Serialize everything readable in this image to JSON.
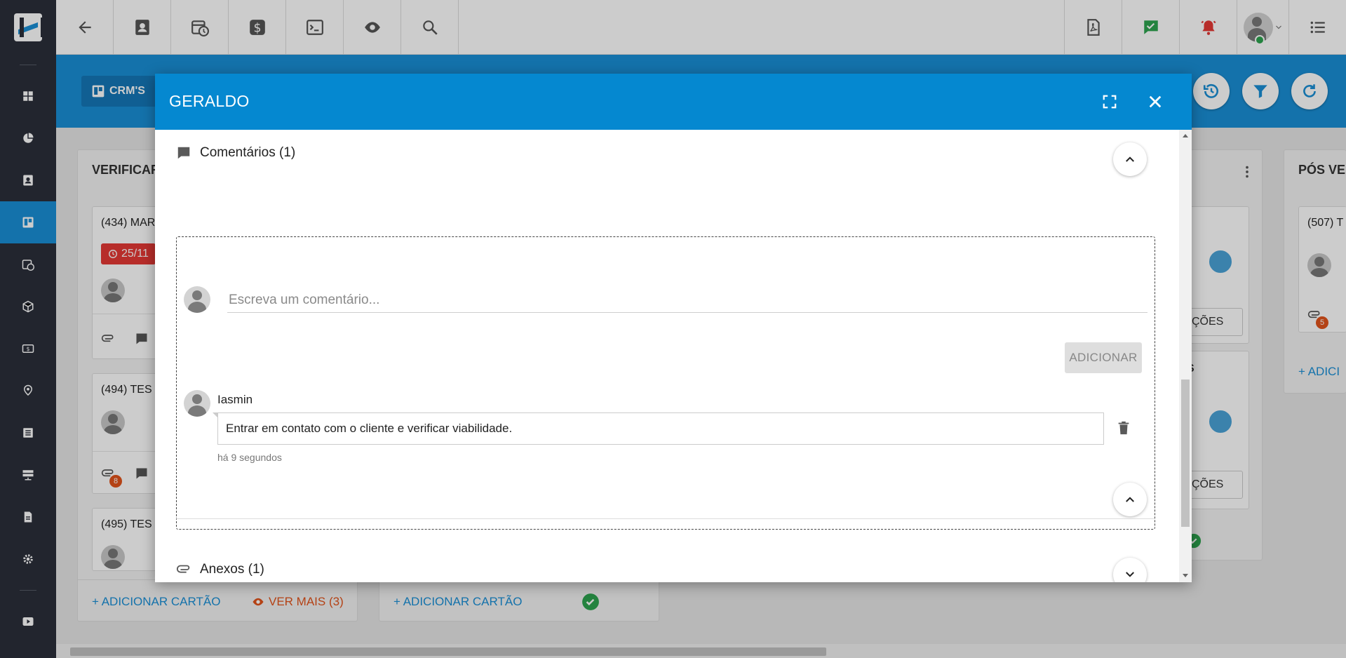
{
  "modal": {
    "title": "GERALDO",
    "comments_section_title": "Comentários (1)",
    "comment_placeholder": "Escreva um comentário...",
    "add_button": "ADICIONAR",
    "comments": [
      {
        "author": "Iasmin",
        "text": "Entrar em contato com o cliente e verificar viabilidade.",
        "time": "há 9 segundos"
      }
    ],
    "attachments_section_title": "Anexos (1)"
  },
  "header": {
    "crm_chip": "CRM'S"
  },
  "board": {
    "columns": [
      {
        "title": "VERIFICAR",
        "cards": [
          {
            "title": "(434) MAR",
            "date_chip": "25/11"
          },
          {
            "title": "(494) TES",
            "badge": "8"
          },
          {
            "title": "(495) TES"
          }
        ],
        "add_card": "ADICIONAR CARTÃO",
        "see_more": "VER MAIS (3)"
      },
      {
        "add_card": "ADICIONAR CARTÃO"
      },
      {
        "card_fragments": [
          "ÇÕES",
          "S",
          "ÇÕES"
        ]
      },
      {
        "title": "PÓS VEN",
        "cards": [
          {
            "title": "(507) T",
            "badge": "5"
          }
        ],
        "add_card": "ADICI"
      }
    ]
  },
  "colors": {
    "primary": "#0588d0",
    "sidebar": "#2b2f3a",
    "accent_orange": "#e2531b",
    "danger_red": "#e53935",
    "success_green": "#2ea44f"
  }
}
